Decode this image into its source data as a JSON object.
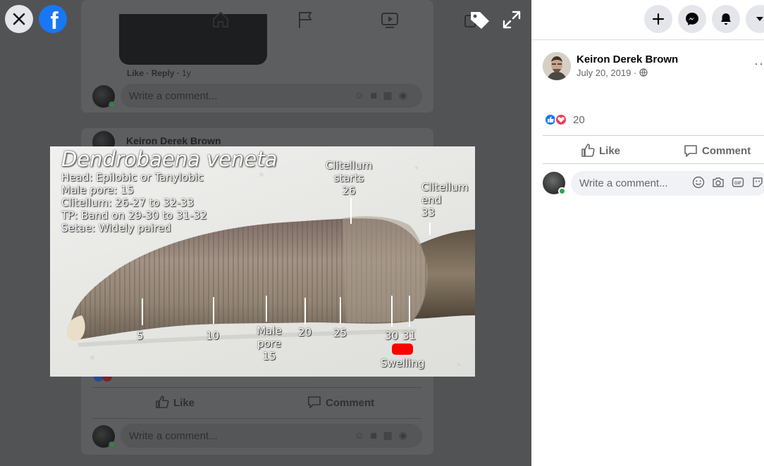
{
  "viewer": {
    "bg": {
      "like_label": "Like",
      "reply_label": "Reply",
      "age": "1y",
      "author_name": "Keiron Derek Brown",
      "comment_placeholder": "Write a comment...",
      "like_action": "Like",
      "comment_action": "Comment"
    },
    "photo": {
      "title": "Dendrobaena veneta",
      "info_lines": [
        "Head: Epilobic or Tanylobic",
        "Male pore: 15",
        "Clitellum: 26-27 to 32-33",
        "TP: Band on 29-30 to 31-32",
        "Setae: Widely paired"
      ],
      "clitellum_start": [
        "Clitellum",
        "starts",
        "26"
      ],
      "clitellum_end": [
        "Clitellum",
        "end",
        "33"
      ],
      "segments": [
        "5",
        "10",
        "20",
        "25",
        "30",
        "31"
      ],
      "male_pore": [
        "Male",
        "pore",
        "15"
      ],
      "swelling": "Swelling"
    }
  },
  "panel": {
    "author_name": "Keiron Derek Brown",
    "post_date": "July 20, 2019 · ",
    "more": "···",
    "reaction_count": "20",
    "like_label": "Like",
    "comment_label": "Comment",
    "comment_placeholder": "Write a comment..."
  },
  "colors": {
    "brand": "#1877f2",
    "love": "#f33e58",
    "viewer_bg": "#525355",
    "swelling_marker": "#ff0000"
  },
  "icons": [
    "close-icon",
    "facebook-logo",
    "home-icon",
    "flag-icon",
    "watch-icon",
    "tag-icon",
    "expand-icon",
    "plus-icon",
    "messenger-icon",
    "notification-icon",
    "caret-down-icon",
    "globe-icon",
    "like-icon",
    "comment-icon",
    "emoji-icon",
    "camera-icon",
    "gif-icon",
    "sticker-icon"
  ]
}
